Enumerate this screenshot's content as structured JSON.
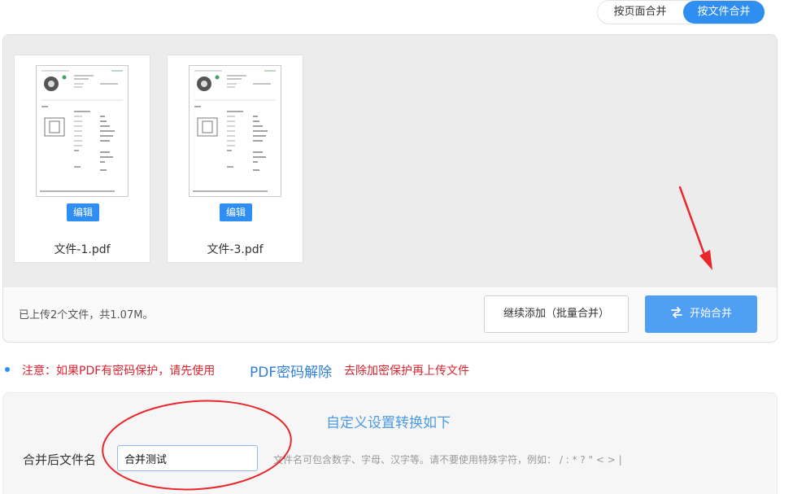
{
  "mode_toggle": {
    "by_page": "按页面合并",
    "by_file": "按文件合并",
    "active": "by_file"
  },
  "files": [
    {
      "name": "文件-1.pdf",
      "edit_label": "编辑"
    },
    {
      "name": "文件-3.pdf",
      "edit_label": "编辑"
    }
  ],
  "upload_panel": {
    "status": "已上传2个文件，共1.07M。",
    "continue_label": "继续添加（批量合并）",
    "start_label": "开始合并"
  },
  "notice": {
    "prefix": "注意：如果PDF有密码保护，请先使用",
    "link": "PDF密码解除",
    "suffix": "去除加密保护再上传文件"
  },
  "settings": {
    "title": "自定义设置转换如下",
    "filename_label": "合并后文件名",
    "filename_value": "合并测试",
    "hint": "文件名可包含数字、字母、汉字等。请不要使用特殊字符，例如： / : * ? \" < > |"
  },
  "colors": {
    "accent": "#2f8ef2",
    "start_button": "#4f9ff5",
    "notice_red": "#d9232e",
    "annotation_red": "#e8262b"
  }
}
